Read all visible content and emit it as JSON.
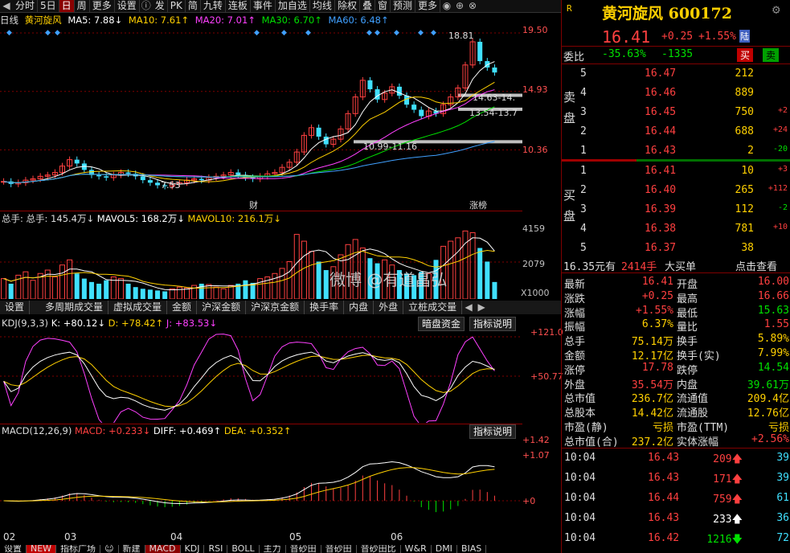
{
  "toolbar": {
    "items": [
      "分时",
      "5日",
      "日",
      "周",
      "更多",
      "设置",
      "发",
      "PK",
      "简",
      "九转",
      "连板",
      "事件",
      "加自选",
      "均线",
      "除权",
      "叠",
      "窗",
      "预测",
      "更多"
    ],
    "active": "日"
  },
  "chart_header": {
    "label": "日线",
    "name": "黄河旋风",
    "ma5": "MA5: 7.88↓",
    "ma10": "MA10: 7.61↑",
    "ma20": "MA20: 7.01↑",
    "ma30": "MA30: 6.70↑",
    "ma60": "MA60: 6.48↑"
  },
  "price_axis": [
    "19.50",
    "14.93",
    "10.36"
  ],
  "annotations": {
    "high": "18.81",
    "low": "7.53",
    "zone1": "14.63-14.",
    "zone2": "13.54-13.7",
    "zone3": "10.99-11.16",
    "mark_cai": "财",
    "mark_zhangbang": "涨榜"
  },
  "chart_data": [
    {
      "type": "candlestick",
      "title": "日线",
      "series": [
        {
          "name": "MA5",
          "last": 7.88,
          "color": "#ffffff"
        },
        {
          "name": "MA10",
          "last": 7.61,
          "color": "#ffd000"
        },
        {
          "name": "MA20",
          "last": 7.01,
          "color": "#ff40ff"
        },
        {
          "name": "MA30",
          "last": 6.7,
          "color": "#00e000"
        },
        {
          "name": "MA60",
          "last": 6.48,
          "color": "#40a0ff"
        }
      ],
      "closes": [
        7.9,
        7.7,
        7.8,
        8.0,
        8.1,
        8.3,
        8.4,
        8.6,
        9.1,
        9.6,
        9.3,
        8.8,
        8.4,
        8.3,
        8.2,
        8.4,
        8.6,
        8.5,
        8.3,
        8.0,
        7.8,
        7.6,
        7.53,
        7.7,
        7.8,
        8.0,
        8.1,
        8.0,
        8.2,
        8.3,
        8.4,
        8.6,
        8.4,
        8.2,
        8.1,
        8.3,
        8.5,
        8.6,
        9.0,
        9.4,
        10.2,
        11.5,
        12.1,
        11.4,
        10.8,
        11.2,
        12.0,
        13.2,
        14.5,
        15.8,
        15.1,
        14.3,
        14.8,
        15.3,
        14.6,
        13.9,
        13.5,
        13.0,
        13.4,
        13.2,
        13.9,
        14.5,
        15.2,
        17.0,
        18.81,
        17.3,
        16.8,
        16.41
      ],
      "ylim": [
        6.5,
        19.5
      ]
    },
    {
      "type": "bar",
      "title": "总手",
      "series_labels": [
        "总手: 145.4万↓",
        "MAVOL5: 168.2万↓",
        "MAVOL10: 216.1万↓"
      ],
      "axis": [
        "4159",
        "2079",
        "X1000"
      ],
      "values": [
        1200,
        900,
        1400,
        1600,
        1100,
        1500,
        1700,
        1300,
        2000,
        2300,
        1500,
        1200,
        1000,
        900,
        1100,
        1300,
        1200,
        900,
        700,
        600,
        550,
        500,
        450,
        600,
        700,
        650,
        800,
        900,
        850,
        700,
        600,
        800,
        900,
        1100,
        950,
        1200,
        1300,
        1500,
        1800,
        2200,
        3800,
        3400,
        2800,
        2200,
        1700,
        1900,
        2600,
        3200,
        3500,
        3000,
        2400,
        2100,
        2300,
        2000,
        1700,
        1500,
        1400,
        1600,
        1500,
        2300,
        3100,
        3400,
        3600,
        4000,
        3900,
        3000,
        2200,
        1000
      ]
    },
    {
      "type": "line",
      "title": "KDJ(9,3,3)",
      "series_labels": [
        "K: +80.12↓",
        "D: +78.42↑",
        "J: +83.53↓"
      ],
      "axis": [
        "+121.0",
        "+50.77"
      ]
    },
    {
      "type": "bar",
      "title": "MACD(12,26,9)",
      "series_labels": [
        "MACD: +0.233↓",
        "DIFF: +0.469↑",
        "DEA: +0.352↑"
      ],
      "axis": [
        "+1.42",
        "+1.07",
        "+0"
      ]
    }
  ],
  "x_dates": [
    "02",
    "03",
    "04",
    "05",
    "06"
  ],
  "tabs": [
    "设置",
    "",
    "多周期成交量",
    "虚拟成交量",
    "金额",
    "沪深金额",
    "沪深京金额",
    "换手率",
    "内盘",
    "外盘",
    "立桩成交量"
  ],
  "ind_buttons": {
    "hidden_funds": "暗盘资金",
    "explain1": "指标说明",
    "explain2": "指标说明"
  },
  "bottom_tabs": [
    "设置",
    "NEW",
    "指标广场",
    "☺",
    "新建",
    "MACD",
    "KDJ",
    "RSI",
    "BOLL",
    "主力",
    "音砂田",
    "音砂田",
    "音砂田比",
    "W&R",
    "DMI",
    "BIAS"
  ],
  "watermark": "微博 @有道畠弘",
  "quote": {
    "market": "R",
    "name": "黄河旋风",
    "code": "600172",
    "price": "16.41",
    "change": "+0.25",
    "pct": "+1.55%",
    "tag": "陆",
    "wb_label": "委比",
    "wb": "-35.63%",
    "wc": "-1335",
    "buy_btn": "买",
    "sell_btn": "卖"
  },
  "sell_label": [
    "卖",
    "盘"
  ],
  "buy_label": [
    "买",
    "盘"
  ],
  "asks": [
    {
      "lv": "5",
      "price": "16.47",
      "vol": "212",
      "chg": ""
    },
    {
      "lv": "4",
      "price": "16.46",
      "vol": "889",
      "chg": ""
    },
    {
      "lv": "3",
      "price": "16.45",
      "vol": "750",
      "chg": "+2"
    },
    {
      "lv": "2",
      "price": "16.44",
      "vol": "688",
      "chg": "+24"
    },
    {
      "lv": "1",
      "price": "16.43",
      "vol": "2",
      "chg": "-20"
    }
  ],
  "bids": [
    {
      "lv": "1",
      "price": "16.41",
      "vol": "10",
      "chg": "+3"
    },
    {
      "lv": "2",
      "price": "16.40",
      "vol": "265",
      "chg": "+112"
    },
    {
      "lv": "3",
      "price": "16.39",
      "vol": "112",
      "chg": "-2"
    },
    {
      "lv": "4",
      "price": "16.38",
      "vol": "781",
      "chg": "+10"
    },
    {
      "lv": "5",
      "price": "16.37",
      "vol": "38",
      "chg": ""
    }
  ],
  "big_buy": {
    "price": "16.35元有",
    "vol": "2414手",
    "label": "大买单",
    "link": "点击查看"
  },
  "stats": [
    {
      "k1": "最新",
      "v1": "16.41",
      "c1": "red",
      "k2": "开盘",
      "v2": "16.00",
      "c2": "red"
    },
    {
      "k1": "涨跌",
      "v1": "+0.25",
      "c1": "red",
      "k2": "最高",
      "v2": "16.66",
      "c2": "red"
    },
    {
      "k1": "涨幅",
      "v1": "+1.55%",
      "c1": "red",
      "k2": "最低",
      "v2": "15.63",
      "c2": "green"
    },
    {
      "k1": "振幅",
      "v1": "6.37%",
      "c1": "yellow",
      "k2": "量比",
      "v2": "1.55",
      "c2": "red"
    },
    {
      "k1": "总手",
      "v1": "75.14万",
      "c1": "yellow",
      "k2": "换手",
      "v2": "5.89%",
      "c2": "yellow"
    },
    {
      "k1": "金额",
      "v1": "12.17亿",
      "c1": "yellow",
      "k2": "换手(实)",
      "v2": "7.99%",
      "c2": "yellow"
    },
    {
      "k1": "涨停",
      "v1": "17.78",
      "c1": "red",
      "k2": "跌停",
      "v2": "14.54",
      "c2": "green"
    },
    {
      "k1": "外盘",
      "v1": "35.54万",
      "c1": "red",
      "k2": "内盘",
      "v2": "39.61万",
      "c2": "green"
    },
    {
      "k1": "总市值",
      "v1": "236.7亿",
      "c1": "yellow",
      "k2": "流通值",
      "v2": "209.4亿",
      "c2": "yellow"
    },
    {
      "k1": "总股本",
      "v1": "14.42亿",
      "c1": "yellow",
      "k2": "流通股",
      "v2": "12.76亿",
      "c2": "yellow"
    },
    {
      "k1": "市盈(静)",
      "v1": "亏损",
      "c1": "yellow",
      "k2": "市盈(TTM)",
      "v2": "亏损",
      "c2": "yellow"
    },
    {
      "k1": "总市值(合)",
      "v1": "237.2亿",
      "c1": "yellow",
      "k2": "实体涨幅",
      "v2": "+2.56%",
      "c2": "red"
    }
  ],
  "ticks": [
    {
      "t": "10:04",
      "p": "16.43",
      "v": "209",
      "dir": "up",
      "n": "39"
    },
    {
      "t": "10:04",
      "p": "16.43",
      "v": "171",
      "dir": "up",
      "n": "39"
    },
    {
      "t": "10:04",
      "p": "16.44",
      "v": "759",
      "dir": "up",
      "n": "61"
    },
    {
      "t": "10:04",
      "p": "16.43",
      "v": "233",
      "dir": "flat",
      "n": "36"
    },
    {
      "t": "10:04",
      "p": "16.42",
      "v": "1216",
      "dir": "down",
      "n": "72"
    }
  ]
}
